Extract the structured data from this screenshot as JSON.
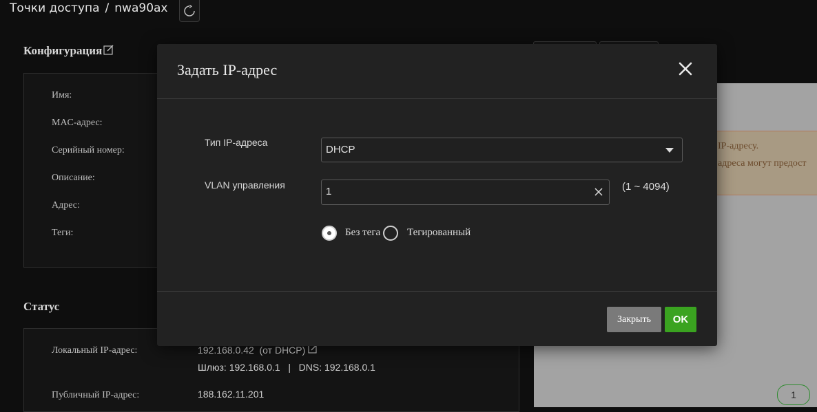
{
  "breadcrumb": {
    "parent": "Точки доступа",
    "separator": "/",
    "current": "nwa90ax"
  },
  "config": {
    "title": "Конфигурация",
    "labels": [
      "Имя:",
      "MAC-адрес:",
      "Серийный номер:",
      "Описание:",
      "Адрес:",
      "Теги:"
    ]
  },
  "status": {
    "title": "Статус",
    "local_ip_label": "Локальный IP-адрес:",
    "local_ip_value": "192.168.0.42  (от DHCP)",
    "gateway_dns": "Шлюз: 192.168.0.1   |   DNS: 192.168.0.1",
    "public_ip_label": "Публичный IP-адрес:",
    "public_ip_value": "188.162.11.201"
  },
  "notice": {
    "line1": "IP-адресу.",
    "line2": "адреса могут предост"
  },
  "pagination": {
    "page": "1"
  },
  "modal": {
    "title": "Задать IP-адрес",
    "ip_type_label": "Тип IP-адреса",
    "ip_type_value": "DHCP",
    "vlan_label": "VLAN управления",
    "vlan_value": "1",
    "vlan_range": "(1 ~ 4094)",
    "radio_untagged": "Без тега",
    "radio_tagged": "Тегированный",
    "radio_selected": "untagged",
    "close_button": "Закрыть",
    "ok_button": "OK"
  },
  "colors": {
    "accent": "#3aa320",
    "modal_bg": "#222222",
    "page_bg": "#0e0e0e"
  }
}
